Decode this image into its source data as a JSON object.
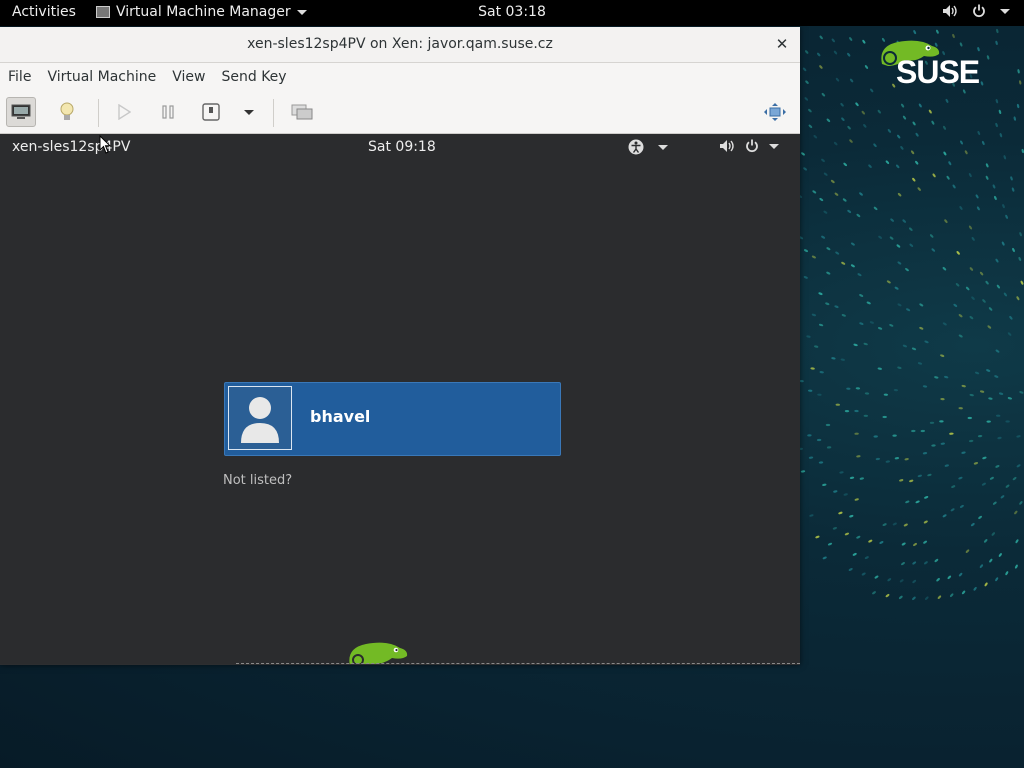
{
  "topbar": {
    "activities": "Activities",
    "app_name": "Virtual Machine Manager",
    "clock": "Sat 03:18",
    "icons": [
      "volume-icon",
      "power-icon",
      "chevron-down-icon"
    ]
  },
  "desktop": {
    "brand_text": "SUSE",
    "accent_color": "#73ba25"
  },
  "window": {
    "title": "xen-sles12sp4PV on Xen: javor.qam.suse.cz",
    "close_glyph": "✕",
    "menu": [
      "File",
      "Virtual Machine",
      "View",
      "Send Key"
    ],
    "toolbar": [
      "console-icon",
      "details-bulb-icon",
      "run-icon",
      "pause-icon",
      "shutdown-icon",
      "shutdown-menu-chevron-icon",
      "snapshots-icon",
      "fullscreen-icon"
    ]
  },
  "guest": {
    "hostname": "xen-sles12sp4PV",
    "clock": "Sat 09:18",
    "user": "bhavel",
    "not_listed": "Not listed?",
    "selection_color": "#215d9c"
  }
}
